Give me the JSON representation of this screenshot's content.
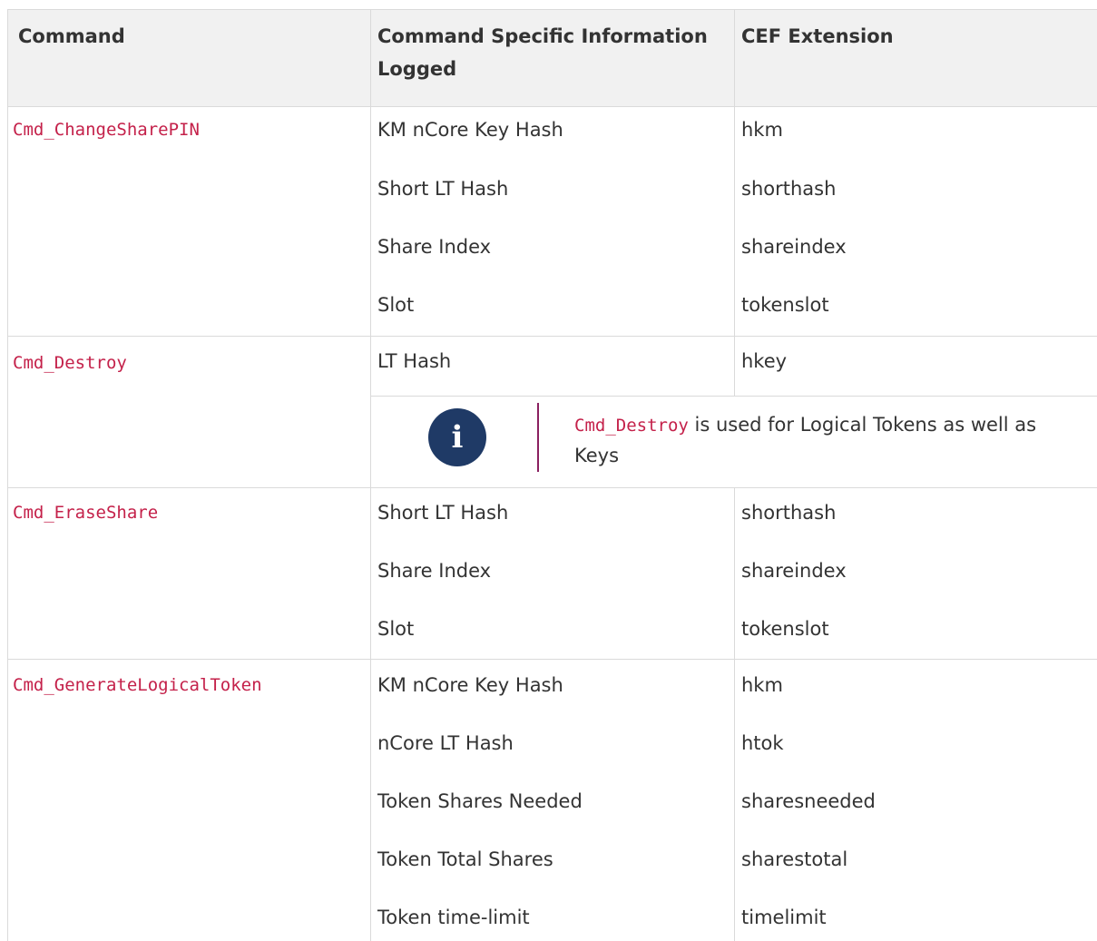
{
  "table": {
    "headers": [
      "Command",
      "Command Specific Information Logged",
      "CEF Extension"
    ],
    "groups": [
      {
        "command": "Cmd_ChangeSharePIN",
        "rows": [
          {
            "info": "KM nCore Key Hash",
            "cef": "hkm"
          },
          {
            "info": "Short LT Hash",
            "cef": "shorthash"
          },
          {
            "info": "Share Index",
            "cef": "shareindex"
          },
          {
            "info": "Slot",
            "cef": "tokenslot"
          }
        ]
      },
      {
        "command": "Cmd_Destroy",
        "rows": [
          {
            "info": "LT Hash",
            "cef": "hkey"
          }
        ],
        "note": {
          "icon": "info-icon",
          "code": "Cmd_Destroy",
          "text": " is used for Logical Tokens as well as Keys"
        }
      },
      {
        "command": "Cmd_EraseShare",
        "rows": [
          {
            "info": "Short LT Hash",
            "cef": "shorthash"
          },
          {
            "info": "Share Index",
            "cef": "shareindex"
          },
          {
            "info": "Slot",
            "cef": "tokenslot"
          }
        ]
      },
      {
        "command": "Cmd_GenerateLogicalToken",
        "rows": [
          {
            "info": "KM nCore Key Hash",
            "cef": "hkm"
          },
          {
            "info": "nCore LT Hash",
            "cef": "htok"
          },
          {
            "info": "Token Shares Needed",
            "cef": "sharesneeded"
          },
          {
            "info": "Token Total Shares",
            "cef": "sharestotal"
          },
          {
            "info": "Token time-limit",
            "cef": "timelimit"
          }
        ]
      }
    ]
  },
  "colors": {
    "command_text": "#c4214a",
    "note_icon": "#1f3a66",
    "note_bar": "#8a2060",
    "header_bg": "#f1f1f1",
    "rule": "#dadada"
  }
}
